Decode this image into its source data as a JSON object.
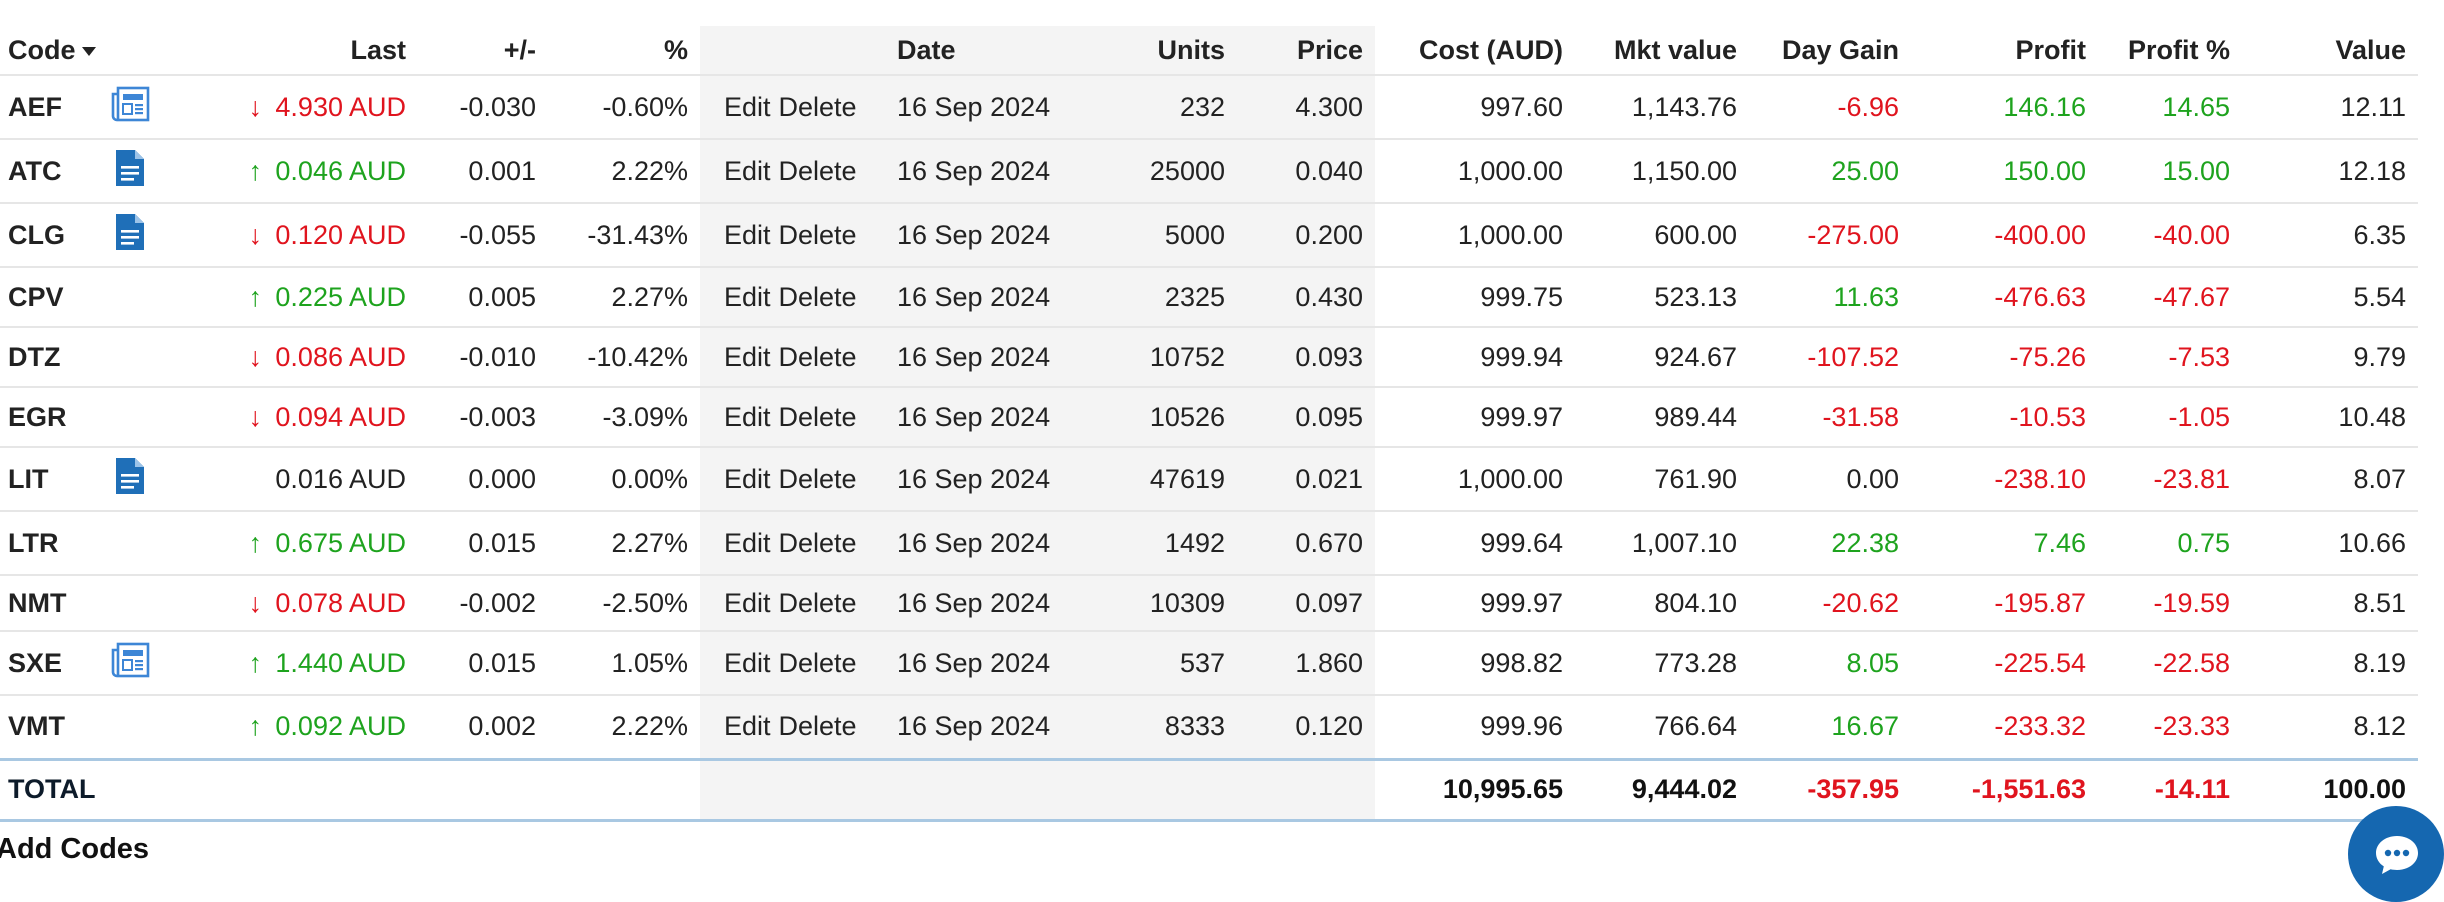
{
  "headers": {
    "code": "Code",
    "last": "Last",
    "change": "+/-",
    "pct": "%",
    "date": "Date",
    "units": "Units",
    "price": "Price",
    "cost": "Cost (AUD)",
    "mkt": "Mkt value",
    "day_gain": "Day Gain",
    "profit": "Profit",
    "profit_pct": "Profit %",
    "value": "Value"
  },
  "actions": {
    "edit": "Edit",
    "delete": "Delete"
  },
  "rows": [
    {
      "code": "AEF",
      "icon": "news-icon",
      "trend": "down",
      "last": "4.930 AUD",
      "change": "-0.030",
      "pct": "-0.60%",
      "date": "16 Sep 2024",
      "units": "232",
      "price": "4.300",
      "cost": "997.60",
      "mkt": "1,143.76",
      "day_gain": "-6.96",
      "profit": "146.16",
      "profit_pct": "14.65",
      "value": "12.11"
    },
    {
      "code": "ATC",
      "icon": "document-icon",
      "trend": "up",
      "last": "0.046 AUD",
      "change": "0.001",
      "pct": "2.22%",
      "date": "16 Sep 2024",
      "units": "25000",
      "price": "0.040",
      "cost": "1,000.00",
      "mkt": "1,150.00",
      "day_gain": "25.00",
      "profit": "150.00",
      "profit_pct": "15.00",
      "value": "12.18"
    },
    {
      "code": "CLG",
      "icon": "document-icon",
      "trend": "down",
      "last": "0.120 AUD",
      "change": "-0.055",
      "pct": "-31.43%",
      "date": "16 Sep 2024",
      "units": "5000",
      "price": "0.200",
      "cost": "1,000.00",
      "mkt": "600.00",
      "day_gain": "-275.00",
      "profit": "-400.00",
      "profit_pct": "-40.00",
      "value": "6.35"
    },
    {
      "code": "CPV",
      "icon": "",
      "trend": "up",
      "last": "0.225 AUD",
      "change": "0.005",
      "pct": "2.27%",
      "date": "16 Sep 2024",
      "units": "2325",
      "price": "0.430",
      "cost": "999.75",
      "mkt": "523.13",
      "day_gain": "11.63",
      "profit": "-476.63",
      "profit_pct": "-47.67",
      "value": "5.54"
    },
    {
      "code": "DTZ",
      "icon": "",
      "trend": "down",
      "last": "0.086 AUD",
      "change": "-0.010",
      "pct": "-10.42%",
      "date": "16 Sep 2024",
      "units": "10752",
      "price": "0.093",
      "cost": "999.94",
      "mkt": "924.67",
      "day_gain": "-107.52",
      "profit": "-75.26",
      "profit_pct": "-7.53",
      "value": "9.79"
    },
    {
      "code": "EGR",
      "icon": "",
      "trend": "down",
      "last": "0.094 AUD",
      "change": "-0.003",
      "pct": "-3.09%",
      "date": "16 Sep 2024",
      "units": "10526",
      "price": "0.095",
      "cost": "999.97",
      "mkt": "989.44",
      "day_gain": "-31.58",
      "profit": "-10.53",
      "profit_pct": "-1.05",
      "value": "10.48"
    },
    {
      "code": "LIT",
      "icon": "document-icon",
      "trend": "flat",
      "last": "0.016 AUD",
      "change": "0.000",
      "pct": "0.00%",
      "date": "16 Sep 2024",
      "units": "47619",
      "price": "0.021",
      "cost": "1,000.00",
      "mkt": "761.90",
      "day_gain": "0.00",
      "profit": "-238.10",
      "profit_pct": "-23.81",
      "value": "8.07"
    },
    {
      "code": "LTR",
      "icon": "",
      "trend": "up",
      "last": "0.675 AUD",
      "change": "0.015",
      "pct": "2.27%",
      "date": "16 Sep 2024",
      "units": "1492",
      "price": "0.670",
      "cost": "999.64",
      "mkt": "1,007.10",
      "day_gain": "22.38",
      "profit": "7.46",
      "profit_pct": "0.75",
      "value": "10.66"
    },
    {
      "code": "NMT",
      "icon": "",
      "trend": "down",
      "last": "0.078 AUD",
      "change": "-0.002",
      "pct": "-2.50%",
      "date": "16 Sep 2024",
      "units": "10309",
      "price": "0.097",
      "cost": "999.97",
      "mkt": "804.10",
      "day_gain": "-20.62",
      "profit": "-195.87",
      "profit_pct": "-19.59",
      "value": "8.51"
    },
    {
      "code": "SXE",
      "icon": "news-icon",
      "trend": "up",
      "last": "1.440 AUD",
      "change": "0.015",
      "pct": "1.05%",
      "date": "16 Sep 2024",
      "units": "537",
      "price": "1.860",
      "cost": "998.82",
      "mkt": "773.28",
      "day_gain": "8.05",
      "profit": "-225.54",
      "profit_pct": "-22.58",
      "value": "8.19"
    },
    {
      "code": "VMT",
      "icon": "",
      "trend": "up",
      "last": "0.092 AUD",
      "change": "0.002",
      "pct": "2.22%",
      "date": "16 Sep 2024",
      "units": "8333",
      "price": "0.120",
      "cost": "999.96",
      "mkt": "766.64",
      "day_gain": "16.67",
      "profit": "-233.32",
      "profit_pct": "-23.33",
      "value": "8.12"
    }
  ],
  "total": {
    "label": "TOTAL",
    "cost": "10,995.65",
    "mkt": "9,444.02",
    "day_gain": "-357.95",
    "profit": "-1,551.63",
    "profit_pct": "-14.11",
    "value": "100.00"
  },
  "footer": {
    "add_codes": "Add Codes"
  },
  "colors": {
    "negative": "#e0141e",
    "positive": "#1ea31e",
    "icon_blue": "#1f6fb8",
    "chat_button": "#1567b0",
    "total_border": "#a9c8e2"
  },
  "icons": {
    "sort": "caret-down-icon",
    "chat": "chat-icon",
    "up": "arrow-up-icon",
    "down": "arrow-down-icon"
  }
}
